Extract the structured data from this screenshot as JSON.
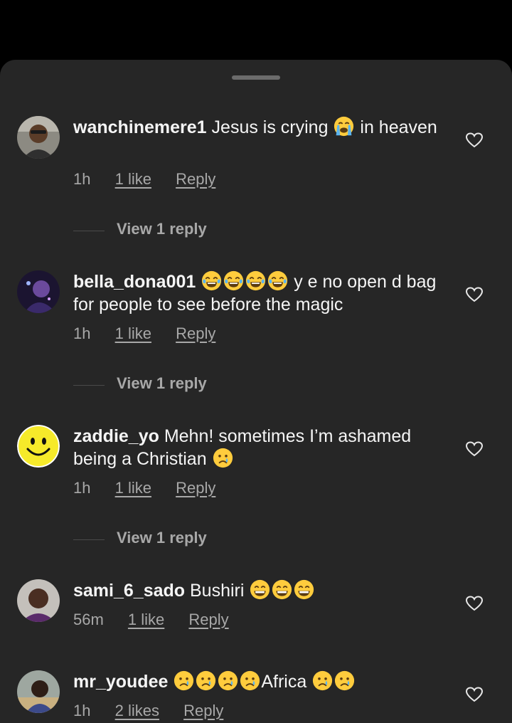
{
  "comments": [
    {
      "username": "wanchinemere1",
      "text_before": "Jesus is crying",
      "emojis": [
        "crying-face"
      ],
      "text_after": "in heaven",
      "time": "1h",
      "likes": "1 like",
      "reply_label": "Reply",
      "view_replies": "View 1 reply"
    },
    {
      "username": "bella_dona001",
      "emojis": [
        "tears-of-joy",
        "tears-of-joy",
        "tears-of-joy",
        "tears-of-joy"
      ],
      "text_after": "y e no open d bag for people to see before the magic",
      "time": "1h",
      "likes": "1 like",
      "reply_label": "Reply",
      "view_replies": "View 1 reply"
    },
    {
      "username": "zaddie_yo",
      "text_before": "Mehn! sometimes I’m ashamed being a Christian",
      "emojis": [
        "crying-tear"
      ],
      "time": "1h",
      "likes": "1 like",
      "reply_label": "Reply",
      "view_replies": "View 1 reply"
    },
    {
      "username": "sami_6_sado",
      "text_before": "Bushiri",
      "emojis": [
        "grin",
        "grin",
        "grin"
      ],
      "time": "56m",
      "likes": "1 like",
      "reply_label": "Reply"
    },
    {
      "username": "mr_youdee",
      "emojis": [
        "crying-tear",
        "crying-tear",
        "crying-tear",
        "crying-tear"
      ],
      "text_after": "Africa",
      "emojis_after": [
        "crying-tear",
        "crying-tear"
      ],
      "time": "1h",
      "likes": "2 likes",
      "reply_label": "Reply"
    }
  ],
  "icons": {
    "heart": "heart-outline-icon",
    "drag_handle": "drag-handle"
  },
  "colors": {
    "sheet_background": "#262626",
    "primary_text": "#f5f5f5",
    "secondary_text": "#a8a8a8"
  }
}
